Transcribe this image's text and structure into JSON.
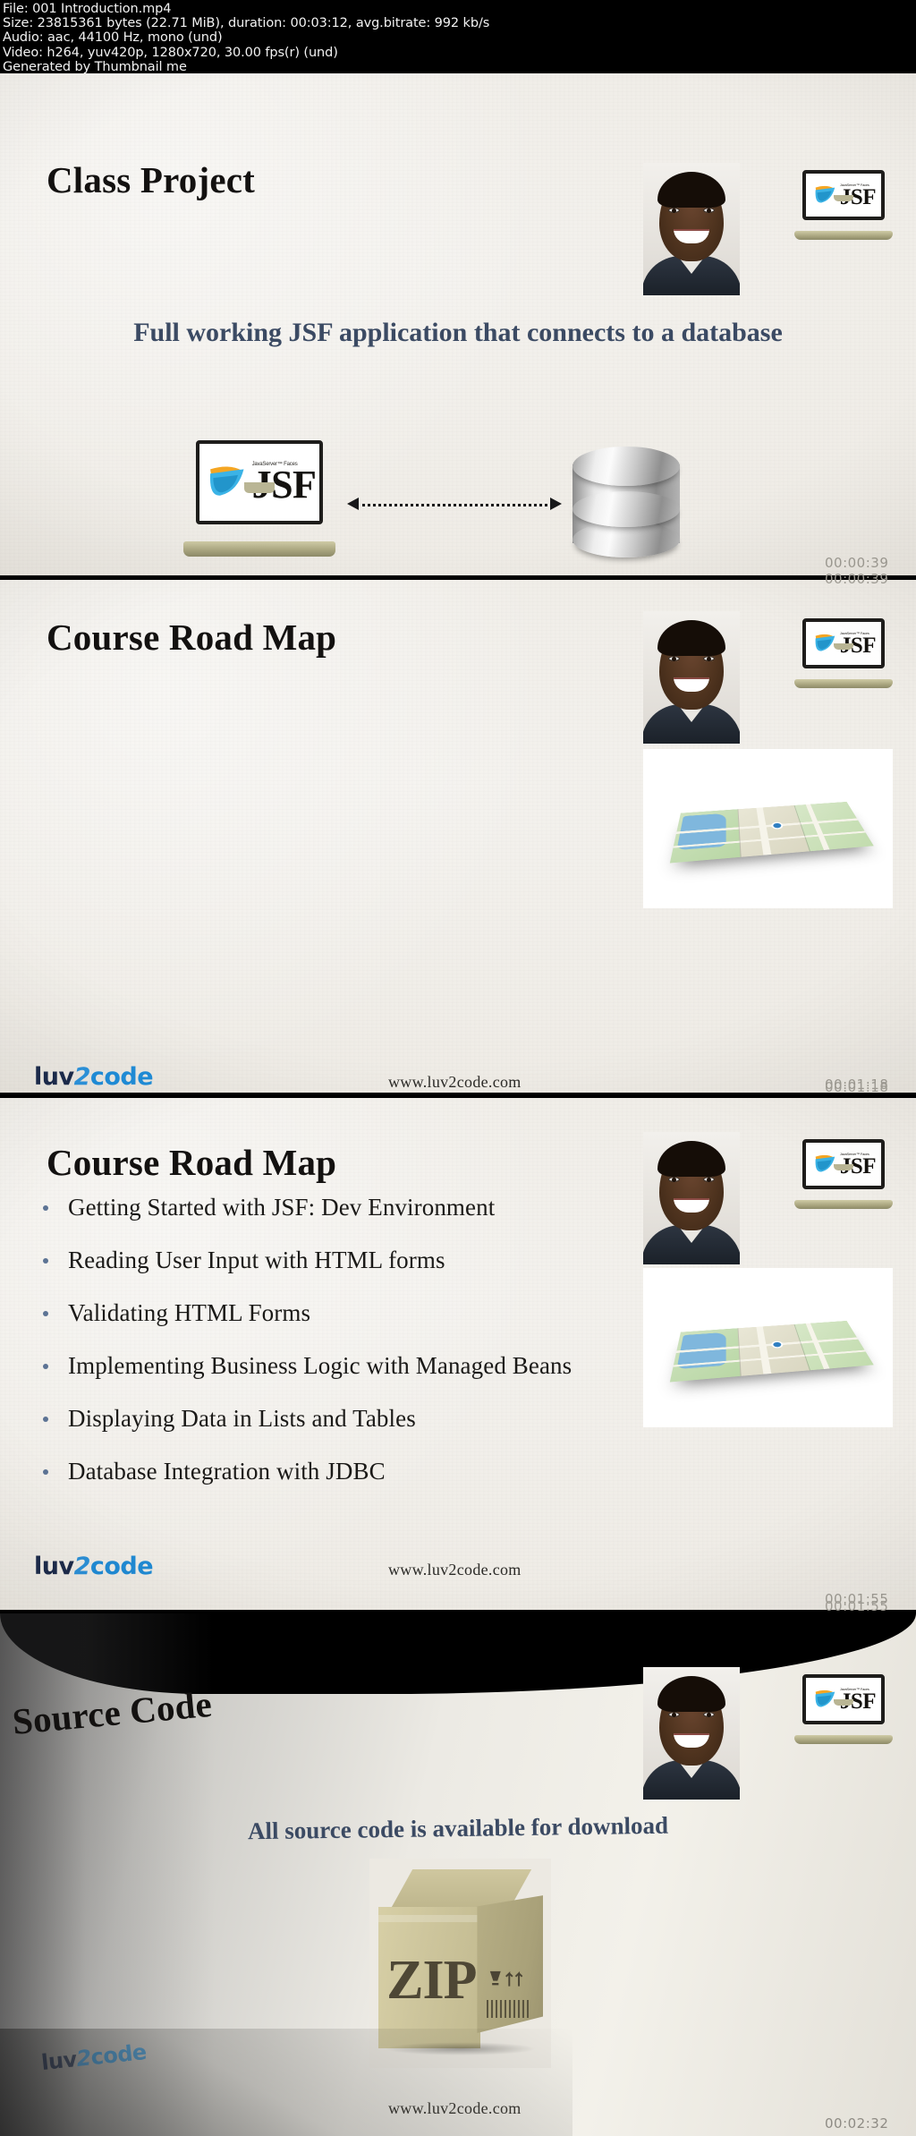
{
  "video_meta": {
    "file_line": "File: 001 Introduction.mp4",
    "size_line": "Size: 23815361 bytes (22.71 MiB), duration: 00:03:12, avg.bitrate: 992 kb/s",
    "audio_line": "Audio: aac, 44100 Hz, mono (und)",
    "video_line": "Video: h264, yuv420p, 1280x720, 30.00 fps(r) (und)",
    "generator_line": "Generated by Thumbnail me"
  },
  "brand": {
    "logo_part1": "luv",
    "logo_part2": "2",
    "logo_part3": "code",
    "website": "www.luv2code.com",
    "accent_blue": "#1f8ad4",
    "navy": "#1b2a4a",
    "heading_navy": "#3b4a63"
  },
  "jsf_logo": {
    "wordmark": "JSF",
    "tagline": "JavaServer™ Faces"
  },
  "slides": [
    {
      "title": "Class Project",
      "subtitle": "Full working JSF application that connects to a database",
      "timestamp": "00:00:39",
      "icons": [
        "laptop-jsf-icon",
        "database-icon",
        "double-arrow-icon"
      ]
    },
    {
      "title": "Course Road Map",
      "subtitle": "",
      "timestamp": "00:01:18",
      "icons": [
        "folded-map-image"
      ]
    },
    {
      "title": "Course Road Map",
      "subtitle": "",
      "timestamp": "00:01:55",
      "bullets": [
        "Getting Started with JSF:  Dev Environment",
        "Reading User Input with HTML forms",
        "Validating HTML Forms",
        "Implementing Business Logic with Managed Beans",
        "Displaying Data in Lists and Tables",
        "Database Integration with JDBC"
      ],
      "icons": [
        "folded-map-image"
      ]
    },
    {
      "title": "Source Code",
      "subtitle": "All source code is available for download",
      "timestamp": "00:02:32",
      "zip_label": "ZIP",
      "icons": [
        "zip-box-icon"
      ]
    }
  ]
}
